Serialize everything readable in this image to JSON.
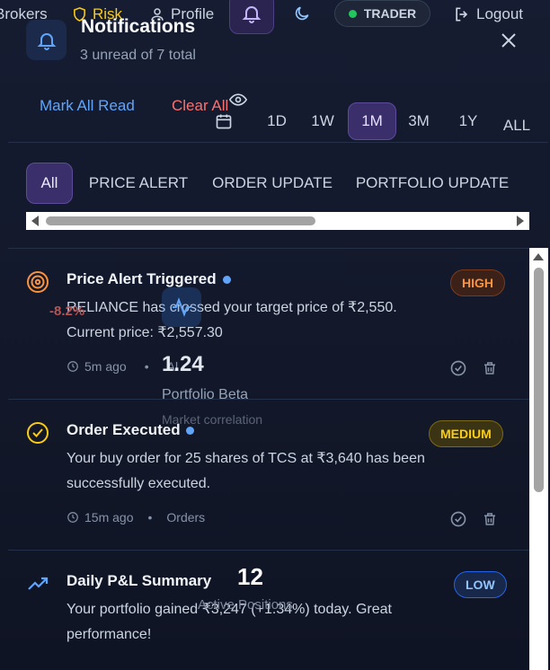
{
  "topnav": {
    "brokers": "Brokers",
    "risk": "Risk",
    "profile": "Profile",
    "trader": "TRADER",
    "logout": "Logout"
  },
  "background": {
    "change": "-8.2%",
    "beta_value": "1.24",
    "beta_label": "Portfolio Beta",
    "beta_sub": "Market correlation",
    "count_value": "12",
    "count_label": "Active Positions",
    "meta_fragment": "Al"
  },
  "panel": {
    "title": "Notifications",
    "subtitle": "3 unread of 7 total",
    "mark_all_read": "Mark All Read",
    "clear_all": "Clear All"
  },
  "periods": [
    "1D",
    "1W",
    "1M",
    "3M",
    "1Y",
    "ALL"
  ],
  "active_period": "1M",
  "filters": [
    "All",
    "PRICE ALERT",
    "ORDER UPDATE",
    "PORTFOLIO UPDATE"
  ],
  "active_filter": "All",
  "notifications": [
    {
      "title": "Price Alert Triggered",
      "message": "RELIANCE has crossed your target price of ₹2,550. Current price: ₹2,557.30",
      "time": "5m ago",
      "category": "",
      "priority": "HIGH",
      "unread": true,
      "icon": "target-icon"
    },
    {
      "title": "Order Executed",
      "message": "Your buy order for 25 shares of TCS at ₹3,640 has been successfully executed.",
      "time": "15m ago",
      "category": "Orders",
      "priority": "MEDIUM",
      "unread": true,
      "icon": "check-circle-icon"
    },
    {
      "title": "Daily P&L Summary",
      "message": "Your portfolio gained ₹3,247 (+1.34%) today. Great performance!",
      "time": "",
      "category": "",
      "priority": "LOW",
      "unread": false,
      "icon": "trending-up-icon"
    }
  ],
  "colors": {
    "accent": "#8b5cf6",
    "high": "#fb923c",
    "medium": "#facc15",
    "low": "#60a5fa",
    "link": "#60a5fa",
    "danger": "#f87171"
  }
}
